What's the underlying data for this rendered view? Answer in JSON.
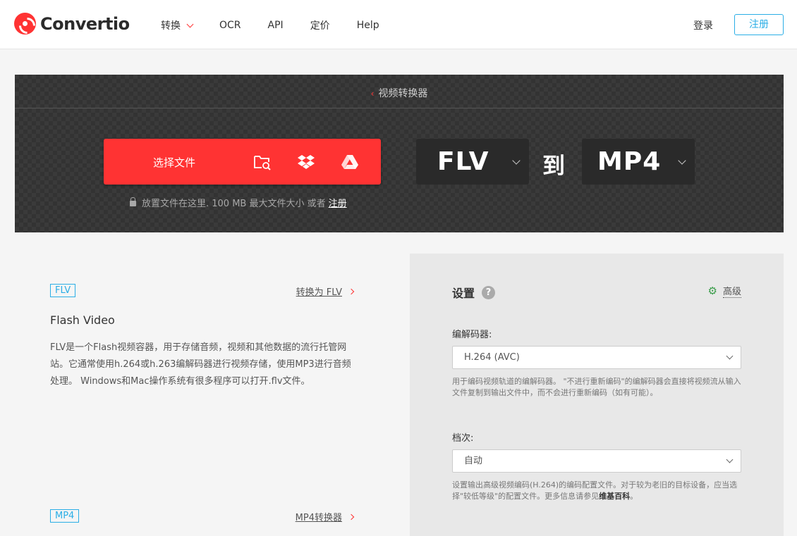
{
  "header": {
    "logo_text": "Convertio",
    "nav": [
      {
        "label": "转换",
        "has_dropdown": true
      },
      {
        "label": "OCR"
      },
      {
        "label": "API"
      },
      {
        "label": "定价"
      },
      {
        "label": "Help"
      }
    ],
    "login_label": "登录",
    "signup_label": "注册"
  },
  "hero": {
    "breadcrumb": "视频转换器",
    "choose_file_label": "选择文件",
    "source_icons": [
      "folder-search-icon",
      "dropbox-icon",
      "google-drive-icon"
    ],
    "drop_hint": "放置文件在这里. 100 MB 最大文件大小 或者",
    "drop_hint_link": "注册",
    "from_format": "FLV",
    "to_word": "到",
    "to_format": "MP4"
  },
  "cards": [
    {
      "badge": "FLV",
      "link": "转换为 FLV",
      "title": "Flash Video",
      "description": "FLV是一个Flash视频容器，用于存储音频，视频和其他数据的流行托管网站。它通常使用h.264或h.263编解码器进行视频存储，使用MP3进行音频处理。 Windows和Mac操作系统有很多程序可以打开.flv文件。"
    },
    {
      "badge": "MP4",
      "link": "MP4转换器"
    }
  ],
  "settings": {
    "title": "设置",
    "help_symbol": "?",
    "advanced_label": "高级",
    "fields": [
      {
        "label": "编解码器:",
        "value": "H.264 (AVC)",
        "help": "用于编码视频轨道的编解码器。 \"不进行重新编码\"的编解码器会直接将视频流从输入文件复制到输出文件中，而不会进行重新编码（如有可能）。"
      },
      {
        "label": "档次:",
        "value": "自动",
        "help_before": "设置输出高级视频编码(H.264)的编码配置文件。对于较为老旧的目标设备，应当选择\"较低等级\"的配置文件。更多信息请参见",
        "help_link": "维基百科",
        "help_after": "。"
      }
    ]
  },
  "colors": {
    "brand_red": "#ff3333",
    "accent_blue": "#2baee6",
    "gear_green": "#3a9d4a"
  }
}
